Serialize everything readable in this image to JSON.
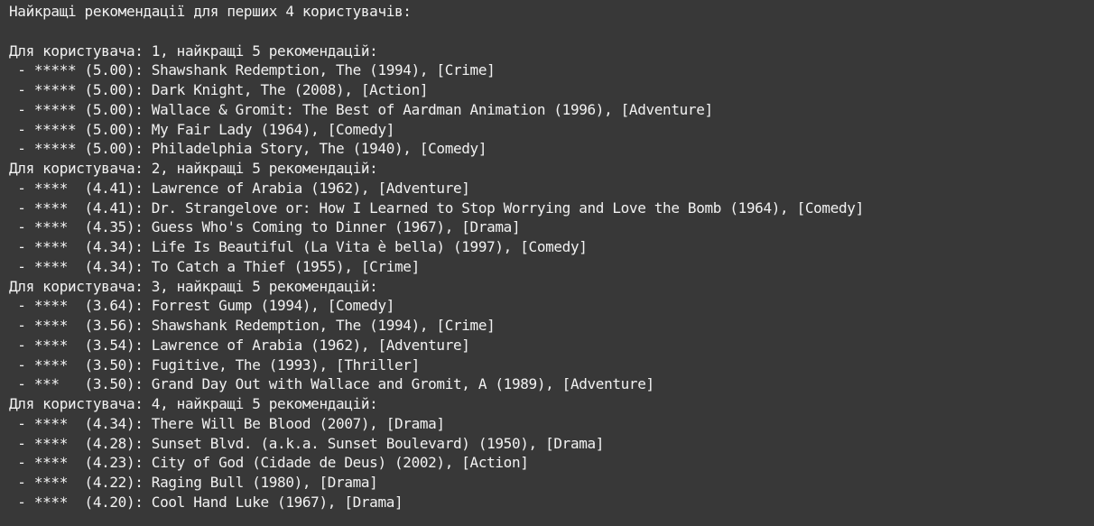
{
  "output": {
    "header": "Найкращі рекомендації для перших 4 користувачів:",
    "users": [
      {
        "heading": "Для користувача: 1, найкращі 5 рекомендацій:",
        "items": [
          " - ***** (5.00): Shawshank Redemption, The (1994), [Crime]",
          " - ***** (5.00): Dark Knight, The (2008), [Action]",
          " - ***** (5.00): Wallace & Gromit: The Best of Aardman Animation (1996), [Adventure]",
          " - ***** (5.00): My Fair Lady (1964), [Comedy]",
          " - ***** (5.00): Philadelphia Story, The (1940), [Comedy]"
        ]
      },
      {
        "heading": "Для користувача: 2, найкращі 5 рекомендацій:",
        "items": [
          " - ****  (4.41): Lawrence of Arabia (1962), [Adventure]",
          " - ****  (4.41): Dr. Strangelove or: How I Learned to Stop Worrying and Love the Bomb (1964), [Comedy]",
          " - ****  (4.35): Guess Who's Coming to Dinner (1967), [Drama]",
          " - ****  (4.34): Life Is Beautiful (La Vita è bella) (1997), [Comedy]",
          " - ****  (4.34): To Catch a Thief (1955), [Crime]"
        ]
      },
      {
        "heading": "Для користувача: 3, найкращі 5 рекомендацій:",
        "items": [
          " - ****  (3.64): Forrest Gump (1994), [Comedy]",
          " - ****  (3.56): Shawshank Redemption, The (1994), [Crime]",
          " - ****  (3.54): Lawrence of Arabia (1962), [Adventure]",
          " - ****  (3.50): Fugitive, The (1993), [Thriller]",
          " - ***   (3.50): Grand Day Out with Wallace and Gromit, A (1989), [Adventure]"
        ]
      },
      {
        "heading": "Для користувача: 4, найкращі 5 рекомендацій:",
        "items": [
          " - ****  (4.34): There Will Be Blood (2007), [Drama]",
          " - ****  (4.28): Sunset Blvd. (a.k.a. Sunset Boulevard) (1950), [Drama]",
          " - ****  (4.23): City of God (Cidade de Deus) (2002), [Action]",
          " - ****  (4.22): Raging Bull (1980), [Drama]",
          " - ****  (4.20): Cool Hand Luke (1967), [Drama]"
        ]
      }
    ]
  }
}
